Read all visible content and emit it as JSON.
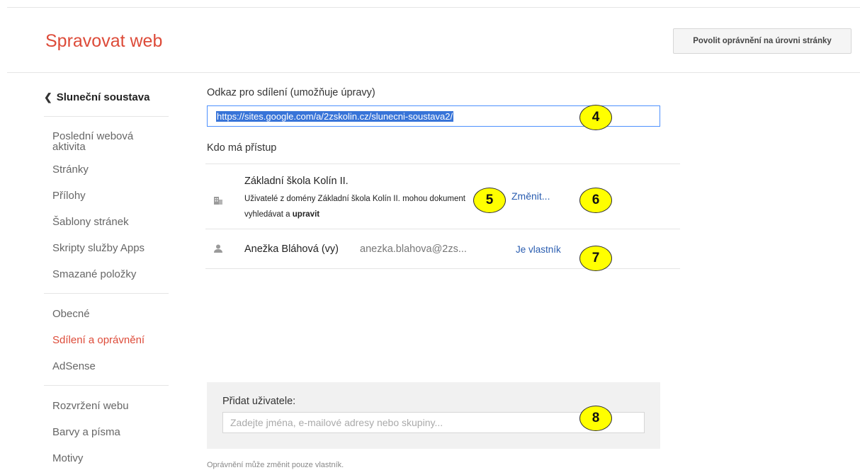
{
  "header": {
    "title": "Spravovat web",
    "permission_button": "Povolit oprávnění na úrovni stránky"
  },
  "sidebar": {
    "back_label": "Sluneční soustava",
    "groups": [
      [
        "Poslední webová aktivita",
        "Stránky",
        "Přílohy",
        "Šablony stránek",
        "Skripty služby Apps",
        "Smazané položky"
      ],
      [
        "Obecné",
        "Sdílení a oprávnění",
        "AdSense"
      ],
      [
        "Rozvržení webu",
        "Barvy a písma",
        "Motivy"
      ]
    ],
    "active": "Sdílení a oprávnění"
  },
  "main": {
    "link_label": "Odkaz pro sdílení (umožňuje úpravy)",
    "link_value": "https://sites.google.com/a/2zskolin.cz/slunecni-soustava2/",
    "access_label": "Kdo má přístup",
    "domain": {
      "name": "Základní škola Kolín II.",
      "desc_pre": "Uživatelé z domény Základní škola Kolín II. mohou dokument vyhledávat a ",
      "desc_bold": "upravit",
      "action": "Změnit..."
    },
    "owner": {
      "name": "Anežka Bláhová (vy)",
      "email": "anezka.blahova@2zs...",
      "role": "Je vlastník"
    },
    "add": {
      "label": "Přidat uživatele:",
      "placeholder": "Zadejte jména, e-mailové adresy nebo skupiny..."
    },
    "footnote": "Oprávnění může změnit pouze vlastník."
  },
  "callouts": [
    "4",
    "5",
    "6",
    "7",
    "8"
  ],
  "colors": {
    "title": "#dd4b39",
    "link": "#2a5db0",
    "callout": "#ffff00",
    "selection": "#3874d8"
  },
  "icons": {
    "domain": "building-icon",
    "owner": "person-icon",
    "back": "chevron-left-icon"
  }
}
